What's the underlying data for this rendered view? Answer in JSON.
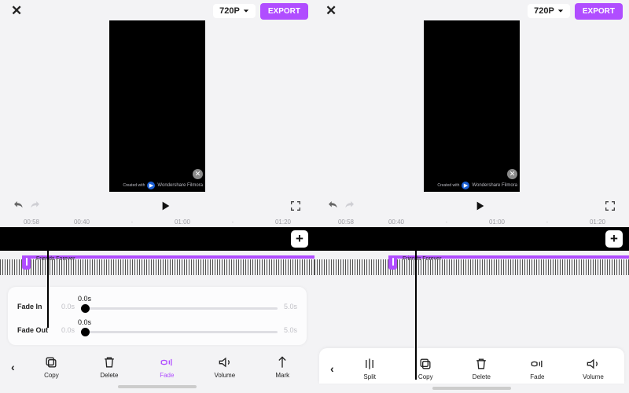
{
  "common": {
    "resolution": "720P",
    "export_label": "EXPORT",
    "watermark": "Wondershare Filmora",
    "ruler": [
      "00:58",
      "00:40",
      "·",
      "01:00",
      "·",
      "01:20"
    ],
    "audio_clip_title": "Friends Forever"
  },
  "left": {
    "fade": {
      "in_label": "Fade In",
      "out_label": "Fade Out",
      "min": "0.0s",
      "max": "5.0s",
      "in_value": "0.0s",
      "out_value": "0.0s"
    },
    "toolbar": {
      "copy": "Copy",
      "delete": "Delete",
      "fade": "Fade",
      "volume": "Volume",
      "mark": "Mark"
    }
  },
  "right": {
    "toolbar": {
      "split": "Split",
      "copy": "Copy",
      "delete": "Delete",
      "fade": "Fade",
      "volume": "Volume"
    }
  }
}
